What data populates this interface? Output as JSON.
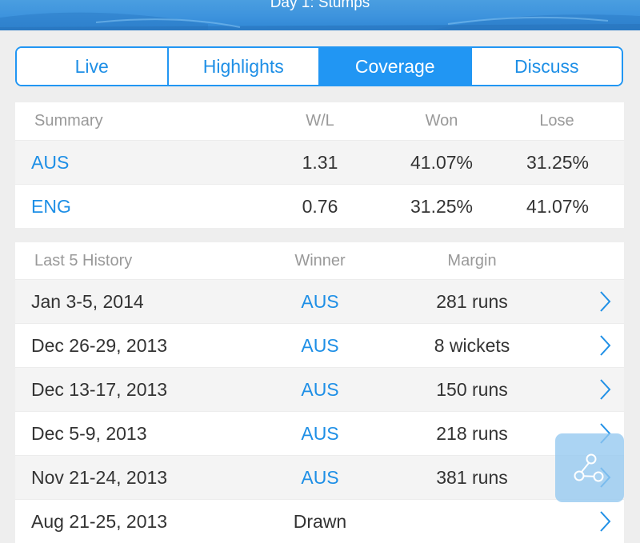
{
  "header": {
    "status": "Day 1: Stumps"
  },
  "tabs": [
    {
      "label": "Live"
    },
    {
      "label": "Highlights"
    },
    {
      "label": "Coverage"
    },
    {
      "label": "Discuss"
    }
  ],
  "active_tab": "Coverage",
  "summary": {
    "headers": {
      "summary": "Summary",
      "wl": "W/L",
      "won": "Won",
      "lose": "Lose"
    },
    "rows": [
      {
        "team": "AUS",
        "wl": "1.31",
        "won": "41.07%",
        "lose": "31.25%"
      },
      {
        "team": "ENG",
        "wl": "0.76",
        "won": "31.25%",
        "lose": "41.07%"
      }
    ]
  },
  "history": {
    "headers": {
      "title": "Last 5 History",
      "winner": "Winner",
      "margin": "Margin"
    },
    "rows": [
      {
        "date": "Jan 3-5, 2014",
        "winner": "AUS",
        "margin": "281 runs"
      },
      {
        "date": "Dec 26-29, 2013",
        "winner": "AUS",
        "margin": "8 wickets"
      },
      {
        "date": "Dec 13-17, 2013",
        "winner": "AUS",
        "margin": "150 runs"
      },
      {
        "date": "Dec 5-9, 2013",
        "winner": "AUS",
        "margin": "218 runs"
      },
      {
        "date": "Nov 21-24, 2013",
        "winner": "AUS",
        "margin": "381 runs"
      },
      {
        "date": "Aug 21-25, 2013",
        "winner": "Drawn",
        "margin": ""
      }
    ]
  },
  "icons": {
    "row_action": "chevron-right-icon",
    "fab": "share-icon"
  },
  "colors": {
    "accent": "#2196f3",
    "link_text": "#1e8fe6",
    "banner": "#3d93dd",
    "fab": "#94c8f0"
  }
}
